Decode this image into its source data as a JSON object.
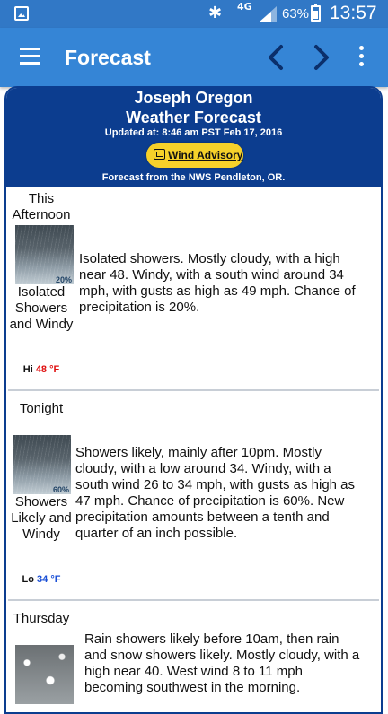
{
  "status_bar": {
    "network": "4G",
    "battery": "63%",
    "time": "13:57"
  },
  "app_bar": {
    "title": "Forecast",
    "icons": [
      "menu-icon",
      "chevron-left-icon",
      "chevron-right-icon",
      "more-vert-icon"
    ]
  },
  "header": {
    "location": "Joseph Oregon",
    "title": "Weather Forecast",
    "updated": "Updated at: 8:46 am PST Feb 17, 2016",
    "advisory": "Wind Advisory",
    "source": "Forecast from the NWS Pendleton, OR."
  },
  "periods": [
    {
      "name": "This Afternoon",
      "pop": "20%",
      "summary": "Isolated Showers and Windy",
      "temp_label": "Hi",
      "temp": "48 °F",
      "temp_color": "#e01010",
      "detail": "Isolated showers. Mostly cloudy, with a high near 48. Windy, with a south wind around 34 mph, with gusts as high as 49 mph. Chance of precipitation is 20%."
    },
    {
      "name": "Tonight",
      "pop": "60%",
      "summary": "Showers Likely and Windy",
      "temp_label": "Lo",
      "temp": "34 °F",
      "temp_color": "#1a4fd6",
      "detail": "Showers likely, mainly after 10pm. Mostly cloudy, with a low around 34. Windy, with a south wind 26 to 34 mph, with gusts as high as 47 mph. Chance of precipitation is 60%. New precipitation amounts between a tenth and quarter of an inch possible."
    },
    {
      "name": "Thursday",
      "detail": "Rain showers likely before 10am, then rain and snow showers likely. Mostly cloudy, with a high near 40. West wind 8 to 11 mph becoming southwest in the morning."
    }
  ],
  "colors": {
    "status_bar": "#3178c6",
    "app_bar": "#3585d6",
    "header": "#0c3d8f",
    "advisory": "#f6d12a"
  }
}
